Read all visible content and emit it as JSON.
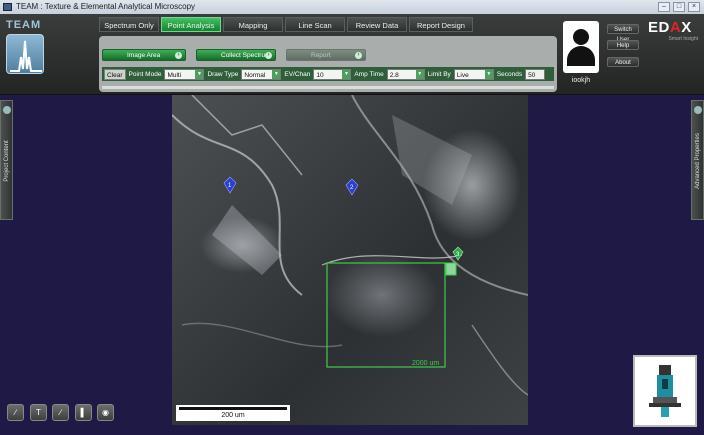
{
  "window": {
    "title": "TEAM : Texture & Elemental Analytical Microscopy"
  },
  "logo": {
    "text": "TEAM"
  },
  "tabs": [
    {
      "label": "Spectrum Only",
      "active": false
    },
    {
      "label": "Point Analysis",
      "active": true
    },
    {
      "label": "Mapping",
      "active": false
    },
    {
      "label": "Line Scan",
      "active": false
    },
    {
      "label": "Review Data",
      "active": false
    },
    {
      "label": "Report Design",
      "active": false
    }
  ],
  "workflow": {
    "image_area": "Image Area",
    "collect_spectrum": "Collect Spectrum",
    "report": "Report"
  },
  "settings": {
    "clear": "Clear",
    "point_mode_label": "Point Mode",
    "point_mode_value": "Multi",
    "draw_type_label": "Draw Type",
    "draw_type_value": "Normal",
    "ev_chan_label": "EV/Chan",
    "ev_chan_value": "10",
    "amp_time_label": "Amp Time",
    "amp_time_value": "2.8",
    "limit_by_label": "Limit By",
    "limit_by_value": "Live",
    "seconds_label": "Seconds",
    "seconds_value": "50"
  },
  "user": {
    "name": "iookjh",
    "switch_user": "Switch User",
    "help": "Help",
    "about": "About"
  },
  "brand": {
    "name_pre": "ED",
    "name_a": "A",
    "name_post": "X",
    "tagline": "Smart Insight"
  },
  "side_panels": {
    "left": "Project Content",
    "right": "Advanced Properties"
  },
  "image": {
    "scale_label": "200 um",
    "roi_label": "2000 um",
    "points": [
      "1",
      "2",
      "3"
    ]
  },
  "colors": {
    "accent": "#1f9a3f",
    "roi": "#3ecb4a",
    "point_marker": "#2b3fd6"
  }
}
